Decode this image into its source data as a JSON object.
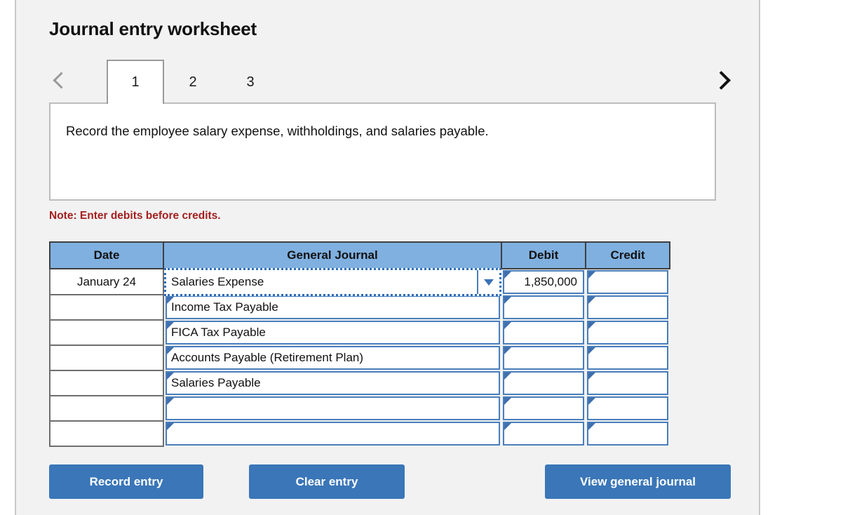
{
  "worksheet": {
    "title": "Journal entry worksheet",
    "note": "Note: Enter debits before credits.",
    "instruction": "Record the employee salary expense, withholdings, and salaries payable."
  },
  "tabs": {
    "prev_icon": "chevron-left-icon",
    "next_icon": "chevron-right-icon",
    "items": [
      {
        "label": "1",
        "active": true
      },
      {
        "label": "2",
        "active": false
      },
      {
        "label": "3",
        "active": false
      }
    ]
  },
  "table": {
    "headers": [
      "Date",
      "General Journal",
      "Debit",
      "Credit"
    ],
    "rows": [
      {
        "date": "January 24",
        "account": "Salaries Expense",
        "debit": "1,850,000",
        "credit": "",
        "selected": true
      },
      {
        "date": "",
        "account": "Income Tax Payable",
        "debit": "",
        "credit": "",
        "selected": false
      },
      {
        "date": "",
        "account": "FICA Tax Payable",
        "debit": "",
        "credit": "",
        "selected": false
      },
      {
        "date": "",
        "account": "Accounts Payable (Retirement Plan)",
        "debit": "",
        "credit": "",
        "selected": false
      },
      {
        "date": "",
        "account": "Salaries Payable",
        "debit": "",
        "credit": "",
        "selected": false
      },
      {
        "date": "",
        "account": "",
        "debit": "",
        "credit": "",
        "selected": false
      },
      {
        "date": "",
        "account": "",
        "debit": "",
        "credit": "",
        "selected": false
      }
    ]
  },
  "buttons": {
    "record": "Record entry",
    "clear": "Clear entry",
    "view": "View general journal"
  },
  "colors": {
    "header_blue": "#7fb0e0",
    "button_blue": "#3a76b8",
    "note_red": "#a32020",
    "cell_border_blue": "#4a7ebb",
    "panel_gray": "#f2f2f2"
  }
}
